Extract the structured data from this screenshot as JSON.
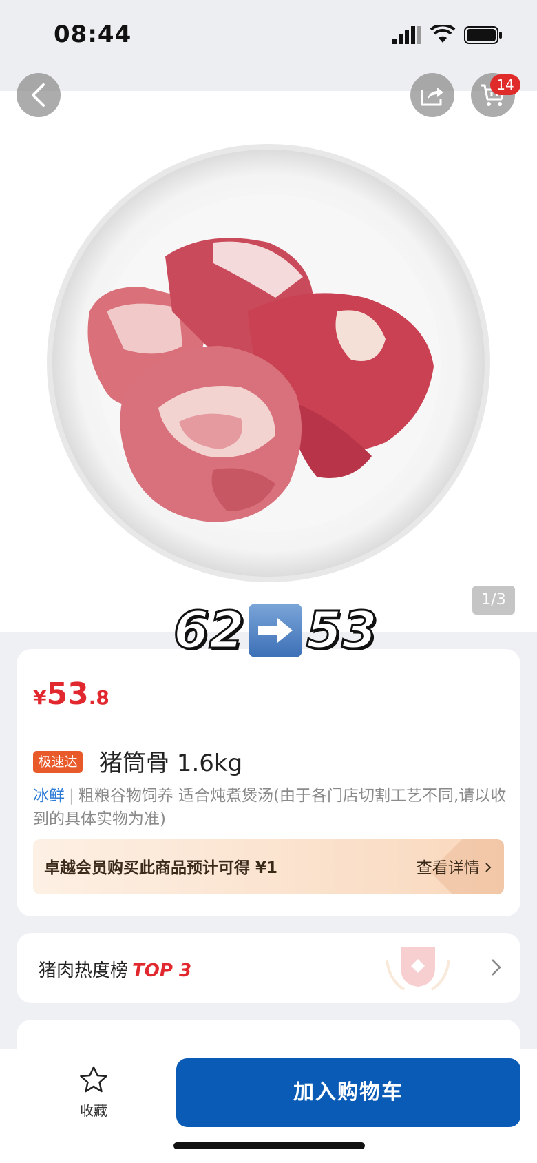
{
  "status": {
    "time": "08:44"
  },
  "header": {
    "cart_count": "14",
    "page_indicator": "1/3"
  },
  "overlay": {
    "from_price": "62",
    "to_price": "53"
  },
  "product": {
    "price_currency": "¥",
    "price_int": "53",
    "price_dec": ".8",
    "speed_tag": "极速达",
    "name": "猪筒骨 1.6kg",
    "fresh_tag": "冰鲜",
    "separator": "|",
    "description": "粗粮谷物饲养 适合炖煮煲汤(由于各门店切割工艺不同,请以收到的具体实物为准)"
  },
  "member": {
    "text": "卓越会员购买此商品预计可得 ¥1",
    "link": "查看详情"
  },
  "ranking": {
    "label": "猪肉热度榜",
    "top": "TOP 3"
  },
  "bottom": {
    "favorite_label": "收藏",
    "add_cart_label": "加入购物车"
  },
  "colors": {
    "price_red": "#e0282e",
    "primary_blue": "#0a5bb5",
    "fresh_blue": "#2b7bd6"
  },
  "icons": [
    "back-icon",
    "share-icon",
    "cart-icon",
    "star-icon",
    "chevron-right-icon",
    "trophy-icon"
  ]
}
